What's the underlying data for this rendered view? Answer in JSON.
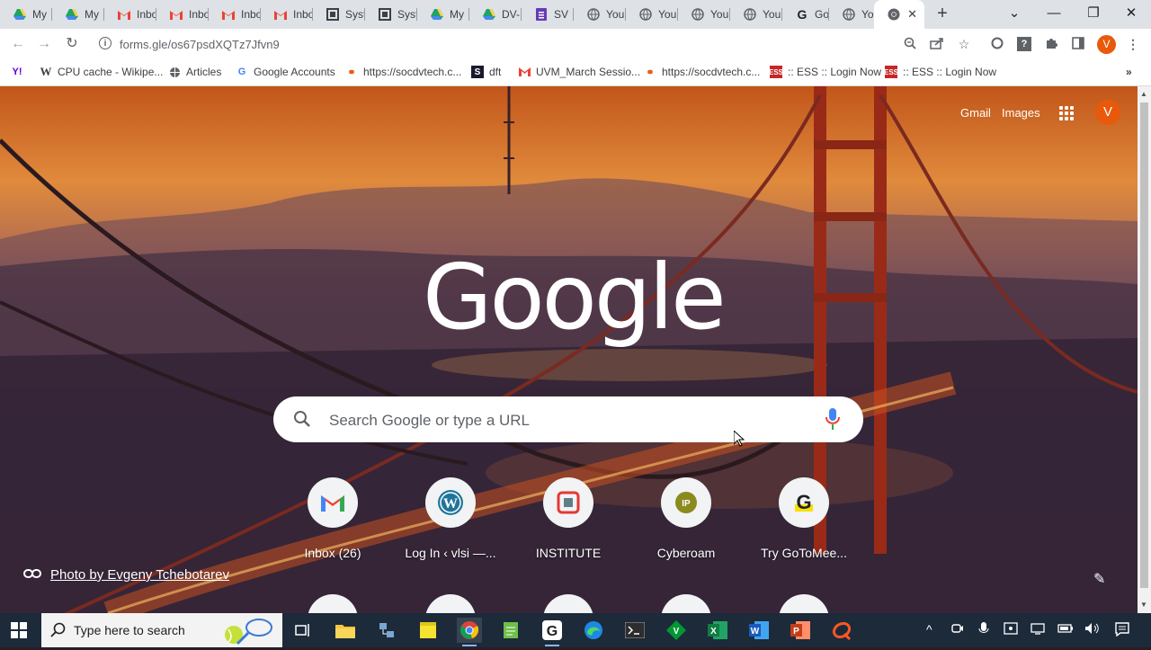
{
  "tabs": [
    {
      "label": "My",
      "icon": "google-drive-icon"
    },
    {
      "label": "My",
      "icon": "google-drive-icon"
    },
    {
      "label": "Inbo",
      "icon": "gmail-icon"
    },
    {
      "label": "Inbo",
      "icon": "gmail-icon"
    },
    {
      "label": "Inbo",
      "icon": "gmail-icon"
    },
    {
      "label": "Inbo",
      "icon": "gmail-icon"
    },
    {
      "label": "Syst",
      "icon": "system-icon"
    },
    {
      "label": "Syst",
      "icon": "system-icon"
    },
    {
      "label": "My",
      "icon": "google-drive-icon"
    },
    {
      "label": "DV-",
      "icon": "google-drive-icon"
    },
    {
      "label": "SV",
      "icon": "forms-icon"
    },
    {
      "label": "You",
      "icon": "globe-icon"
    },
    {
      "label": "You",
      "icon": "globe-icon"
    },
    {
      "label": "You",
      "icon": "globe-icon"
    },
    {
      "label": "You",
      "icon": "globe-icon"
    },
    {
      "label": "GoT",
      "icon": "google-g-icon"
    },
    {
      "label": "You",
      "icon": "globe-icon"
    }
  ],
  "active_tab": {
    "icon": "chrome-icon",
    "close": "✕"
  },
  "new_tab": "+",
  "window_controls": {
    "chevron": "⌄",
    "minimize": "—",
    "restore": "❐",
    "close": "✕"
  },
  "address_bar": {
    "url": "forms.gle/os67psdXQTz7Jfvn9"
  },
  "profile_initial": "V",
  "bookmarks": [
    {
      "label": "",
      "icon": "yahoo-icon"
    },
    {
      "label": "CPU cache - Wikipe...",
      "icon": "wikipedia-icon"
    },
    {
      "label": "Articles",
      "icon": "globe-icon"
    },
    {
      "label": "Google Accounts",
      "icon": "google-g-icon"
    },
    {
      "label": "https://socdvtech.c...",
      "icon": "link-icon"
    },
    {
      "label": "dft",
      "icon": "s-icon"
    },
    {
      "label": "UVM_March Sessio...",
      "icon": "gmail-icon"
    },
    {
      "label": "https://socdvtech.c...",
      "icon": "link-icon"
    },
    {
      "label": ":: ESS :: Login Now",
      "icon": "ess-icon"
    },
    {
      "label": ":: ESS :: Login Now",
      "icon": "ess-icon"
    }
  ],
  "ntp": {
    "gmail_link": "Gmail",
    "images_link": "Images",
    "avatar_initial": "V",
    "logo": "Google",
    "search_placeholder": "Search Google or type a URL",
    "shortcuts": [
      {
        "label": "Inbox (26)",
        "icon": "gmail-icon"
      },
      {
        "label": "Log In ‹ vlsi —...",
        "icon": "wordpress-icon"
      },
      {
        "label": "INSTITUTE",
        "icon": "institute-icon"
      },
      {
        "label": "Cyberoam",
        "icon": "ip-icon"
      },
      {
        "label": "Try GoToMee...",
        "icon": "google-g-icon"
      }
    ],
    "photo_credit": "Photo by Evgeny Tchebotarev"
  },
  "taskbar": {
    "search_placeholder": "Type here to search",
    "apps": [
      "task-view-icon",
      "file-explorer-icon",
      "network-icon",
      "sticky-notes-icon",
      "chrome-icon",
      "notepad-icon",
      "g-app-icon",
      "edge-icon",
      "terminal-icon",
      "vim-icon",
      "excel-icon",
      "word-icon",
      "powerpoint-icon",
      "q-app-icon"
    ]
  },
  "colors": {
    "accent": "#e8590c",
    "taskbar": "#1c2a3a",
    "tabstrip": "#dee1e6"
  }
}
